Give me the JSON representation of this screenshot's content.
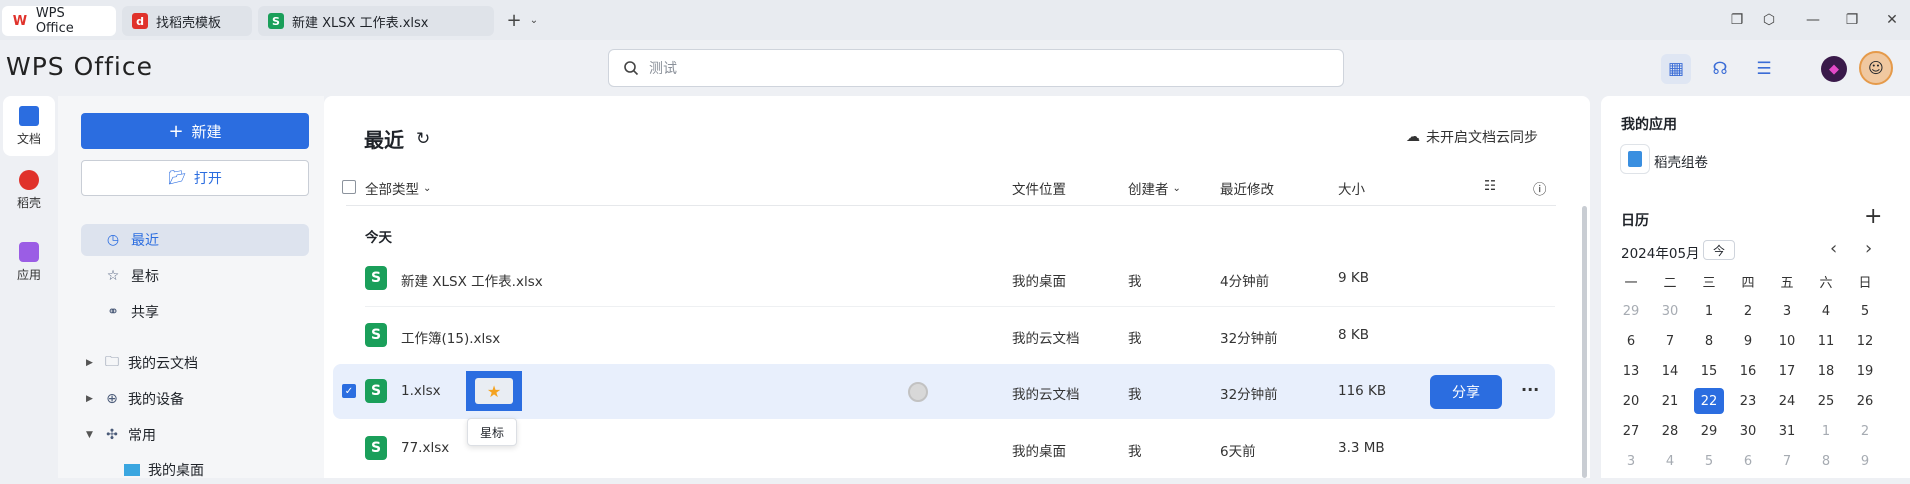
{
  "tabs": [
    {
      "label": "WPS Office",
      "icon": "wps-logo-icon"
    },
    {
      "label": "找稻壳模板",
      "icon": "docer-icon"
    },
    {
      "label": "新建 XLSX 工作表.xlsx",
      "icon": "spreadsheet-icon"
    }
  ],
  "app_logo": "WPS Office",
  "search": {
    "placeholder": "测试"
  },
  "rail": [
    {
      "label": "文档",
      "icon": "document-icon"
    },
    {
      "label": "稻壳",
      "icon": "docer-icon"
    },
    {
      "label": "应用",
      "icon": "apps-icon"
    }
  ],
  "left": {
    "new_label": "新建",
    "open_label": "打开",
    "nav": [
      {
        "label": "最近",
        "icon": "clock-icon"
      },
      {
        "label": "星标",
        "icon": "star-icon"
      },
      {
        "label": "共享",
        "icon": "share-icon"
      }
    ],
    "tree": [
      {
        "label": "我的云文档",
        "icon": "folder-icon"
      },
      {
        "label": "我的设备",
        "icon": "device-icon"
      },
      {
        "label": "常用",
        "icon": "pin-icon"
      },
      {
        "label": "我的桌面",
        "icon": "desktop-icon"
      }
    ]
  },
  "main": {
    "title": "最近",
    "sync": "未开启文档云同步",
    "columns": {
      "type": "全部类型",
      "location": "文件位置",
      "creator": "创建者",
      "modified": "最近修改",
      "size": "大小"
    },
    "group": "今天",
    "files": [
      {
        "name": "新建 XLSX 工作表.xlsx",
        "location": "我的桌面",
        "creator": "我",
        "modified": "4分钟前",
        "size": "9 KB"
      },
      {
        "name": "工作簿(15).xlsx",
        "location": "我的云文档",
        "creator": "我",
        "modified": "32分钟前",
        "size": "8 KB"
      },
      {
        "name": "1.xlsx",
        "location": "我的云文档",
        "creator": "我",
        "modified": "32分钟前",
        "size": "116 KB"
      },
      {
        "name": "77.xlsx",
        "location": "我的桌面",
        "creator": "我",
        "modified": "6天前",
        "size": "3.3 MB"
      }
    ],
    "share_label": "分享",
    "star_tooltip": "星标",
    "more": "···"
  },
  "right": {
    "apps_title": "我的应用",
    "app_name": "稻壳组卷",
    "calendar_title": "日历",
    "month": "2024年05月",
    "today_btn": "今",
    "weekdays": [
      "一",
      "二",
      "三",
      "四",
      "五",
      "六",
      "日"
    ],
    "weeks": [
      [
        "29",
        "30",
        "1",
        "2",
        "3",
        "4",
        "5"
      ],
      [
        "6",
        "7",
        "8",
        "9",
        "10",
        "11",
        "12"
      ],
      [
        "13",
        "14",
        "15",
        "16",
        "17",
        "18",
        "19"
      ],
      [
        "20",
        "21",
        "22",
        "23",
        "24",
        "25",
        "26"
      ],
      [
        "27",
        "28",
        "29",
        "30",
        "31",
        "1",
        "2"
      ],
      [
        "3",
        "4",
        "5",
        "6",
        "7",
        "8",
        "9"
      ]
    ]
  },
  "colors": {
    "accent": "#2b6de0",
    "excel_green": "#1a9f5a",
    "wps_red": "#e0322b"
  }
}
